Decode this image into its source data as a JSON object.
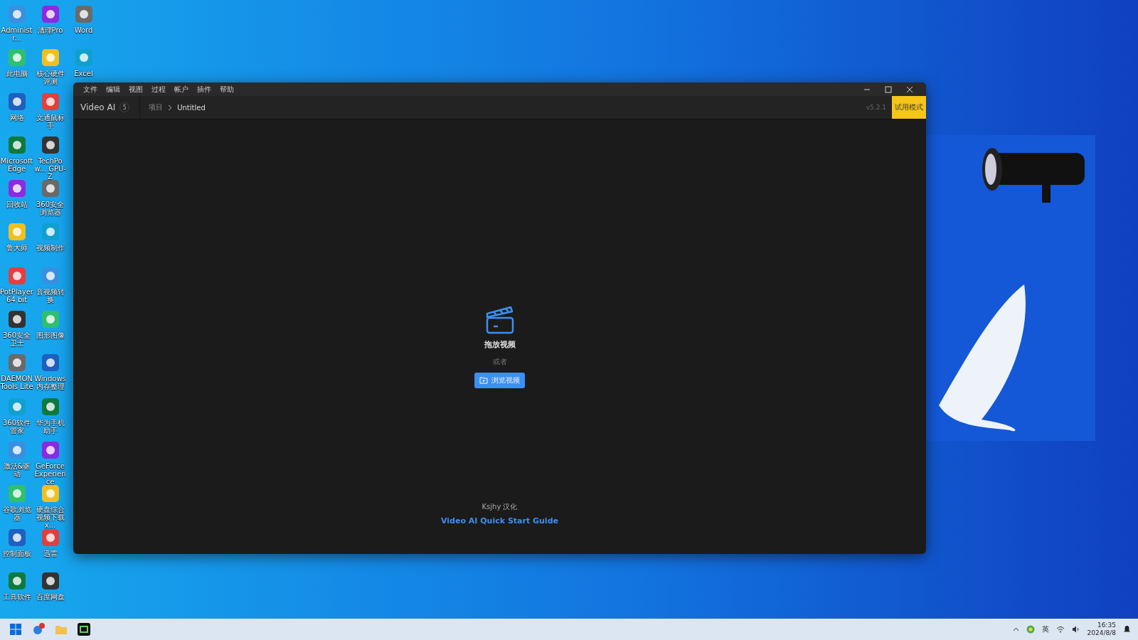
{
  "desktop": {
    "wallpaper": {
      "kind": "picture"
    },
    "icon_columns": [
      [
        {
          "label": "Administr..."
        },
        {
          "label": "此电脑"
        },
        {
          "label": "网络"
        },
        {
          "label": "Microsoft Edge"
        },
        {
          "label": "回收站"
        },
        {
          "label": "鲁大师"
        },
        {
          "label": "PotPlayer 64 bit"
        },
        {
          "label": "360安全卫士"
        },
        {
          "label": "DAEMON Tools Lite"
        },
        {
          "label": "360软件管家"
        },
        {
          "label": "激活&驱动"
        },
        {
          "label": "谷歌浏览器"
        },
        {
          "label": "控制面板"
        },
        {
          "label": "工具软件"
        }
      ],
      [
        {
          "label": "清理Pro"
        },
        {
          "label": "核心硬件评测"
        },
        {
          "label": "文通鼠标手"
        },
        {
          "label": "TechPow... GPU-Z"
        },
        {
          "label": "360安全浏览器"
        },
        {
          "label": "视频制作"
        },
        {
          "label": "音视频转换"
        },
        {
          "label": "图形图像"
        },
        {
          "label": "Windows内存整理"
        },
        {
          "label": "华为手机助手"
        },
        {
          "label": "GeForce Experience"
        },
        {
          "label": "硬盘综合视频下载x..."
        },
        {
          "label": "迅雷"
        },
        {
          "label": "百度网盘"
        }
      ],
      [
        {
          "label": "Word"
        },
        {
          "label": "Excel"
        }
      ]
    ]
  },
  "window": {
    "menu": [
      "文件",
      "编辑",
      "视图",
      "过程",
      "帐户",
      "插件",
      "帮助"
    ],
    "app_name": "Video AI",
    "badge": "5",
    "breadcrumb": [
      "项目",
      "Untitled"
    ],
    "version": "v5.2.1",
    "trial_button": "试用模式",
    "drop_title": "拖放视频",
    "or_text": "或者",
    "browse_button": "浏览视频",
    "credit": "Ksjhy 汉化",
    "guide_link": "Video AI Quick Start Guide"
  },
  "taskbar": {
    "language": "英",
    "time": "16:35",
    "date": "2024/8/8"
  }
}
